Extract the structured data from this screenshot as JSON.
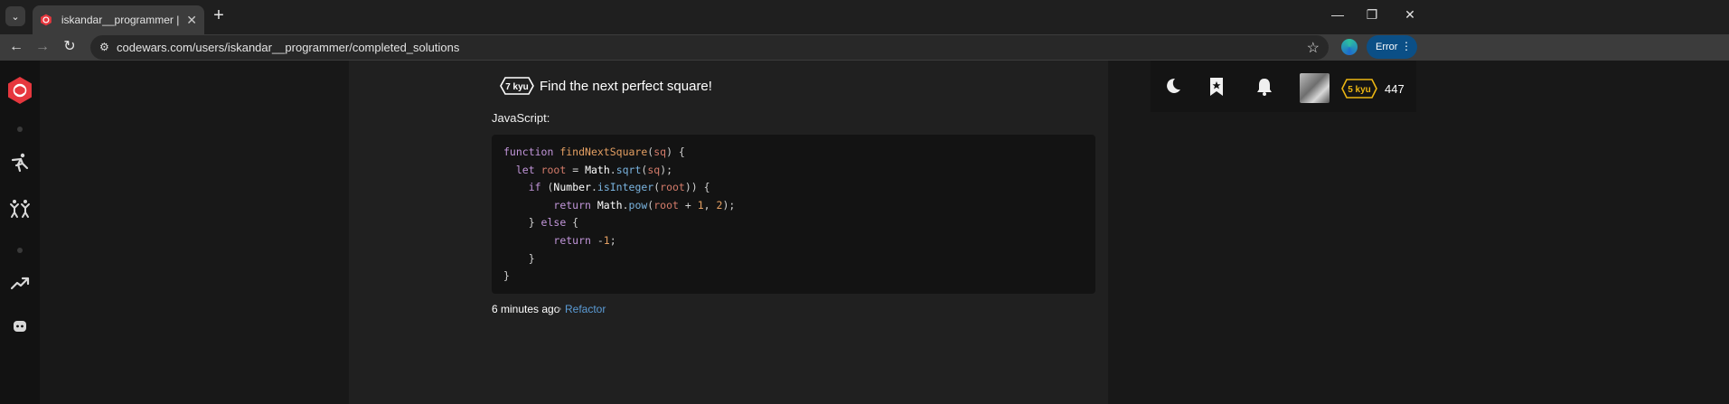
{
  "browser": {
    "tab_title": "iskandar__programmer | Codew",
    "url": "codewars.com/users/iskandar__programmer/completed_solutions",
    "profile_button": "Error"
  },
  "user": {
    "rank": "5 kyu",
    "honor": "447"
  },
  "solution": {
    "kyu": "7 kyu",
    "title": "Find the next perfect square!",
    "language": "JavaScript:",
    "time": "6 minutes ago",
    "separator": "•",
    "refactor_label": "Refactor",
    "code_lines": [
      "function findNextSquare(sq) {",
      "  let root = Math.sqrt(sq);",
      "    if (Number.isInteger(root)) {",
      "        return Math.pow(root + 1, 2);",
      "    } else {",
      "        return -1;",
      "    }",
      "}"
    ]
  },
  "colors": {
    "accent_red": "#e6373e",
    "rank_yellow": "#ecb613",
    "link_blue": "#5b9bd5"
  }
}
